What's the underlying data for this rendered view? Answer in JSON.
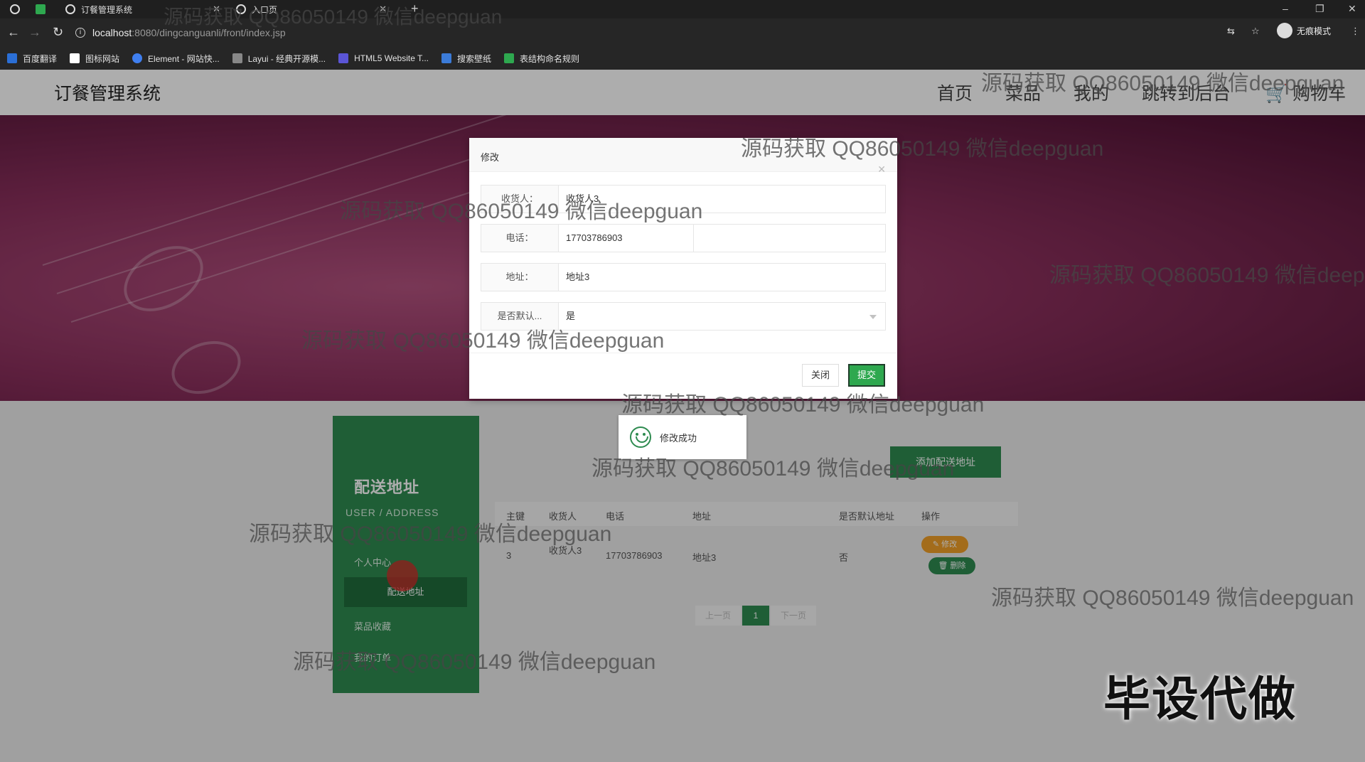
{
  "browser": {
    "tabs": [
      {
        "title": ""
      },
      {
        "title": ""
      },
      {
        "title": "订餐管理系统"
      },
      {
        "title": "入口页"
      }
    ],
    "url_host": "localhost",
    "url_path": ":8080/dingcanguanli/front/index.jsp",
    "profile_label": "无痕模式",
    "bookmarks": [
      {
        "label": "百度翻译",
        "color": "#2b6fd6"
      },
      {
        "label": "图标网站",
        "color": "#ffffff"
      },
      {
        "label": "Element - 网站快...",
        "color": "#3f7ff0"
      },
      {
        "label": "Layui - 经典开源模...",
        "color": "#888888"
      },
      {
        "label": "HTML5 Website T...",
        "color": "#5b55d6"
      },
      {
        "label": "搜索壁纸",
        "color": "#3b7bd8"
      },
      {
        "label": "表结构命名规则",
        "color": "#2ea84f"
      }
    ]
  },
  "site": {
    "brand": "订餐管理系统",
    "nav": [
      "首页",
      "菜品",
      "我的",
      "跳转到后台",
      "购物车"
    ]
  },
  "sidebar": {
    "title": "配送地址",
    "subtitle": "USER / ADDRESS",
    "items": [
      "个人中心",
      "配送地址",
      "菜品收藏",
      "我的订单"
    ]
  },
  "main": {
    "add_button": "添加配送地址",
    "columns": [
      "主键",
      "收货人",
      "电话",
      "地址",
      "是否默认地址",
      "操作"
    ],
    "rows": [
      {
        "id": "3",
        "receiver": "收货人3",
        "phone": "17703786903",
        "address": "地址3",
        "is_default": "否"
      }
    ],
    "edit_label": "修改",
    "delete_label": "删除",
    "pager": {
      "prev": "上一页",
      "current": "1",
      "next": "下一页"
    }
  },
  "toast": {
    "message": "修改成功"
  },
  "modal": {
    "title": "修改",
    "fields": [
      {
        "label": "收货人：",
        "value": "收货人3"
      },
      {
        "label": "电话：",
        "value": "17703786903"
      },
      {
        "label": "地址：",
        "value": "地址3"
      },
      {
        "label": "是否默认...",
        "value": "是"
      }
    ],
    "close_button": "关闭",
    "submit_button": "提交"
  },
  "watermark": "源码获取 QQ86050149 微信deepguan",
  "corner_text": "毕设代做",
  "colors": {
    "accent": "#2e8b50",
    "warning": "#f0a028",
    "banner": "#8a2f5c"
  }
}
